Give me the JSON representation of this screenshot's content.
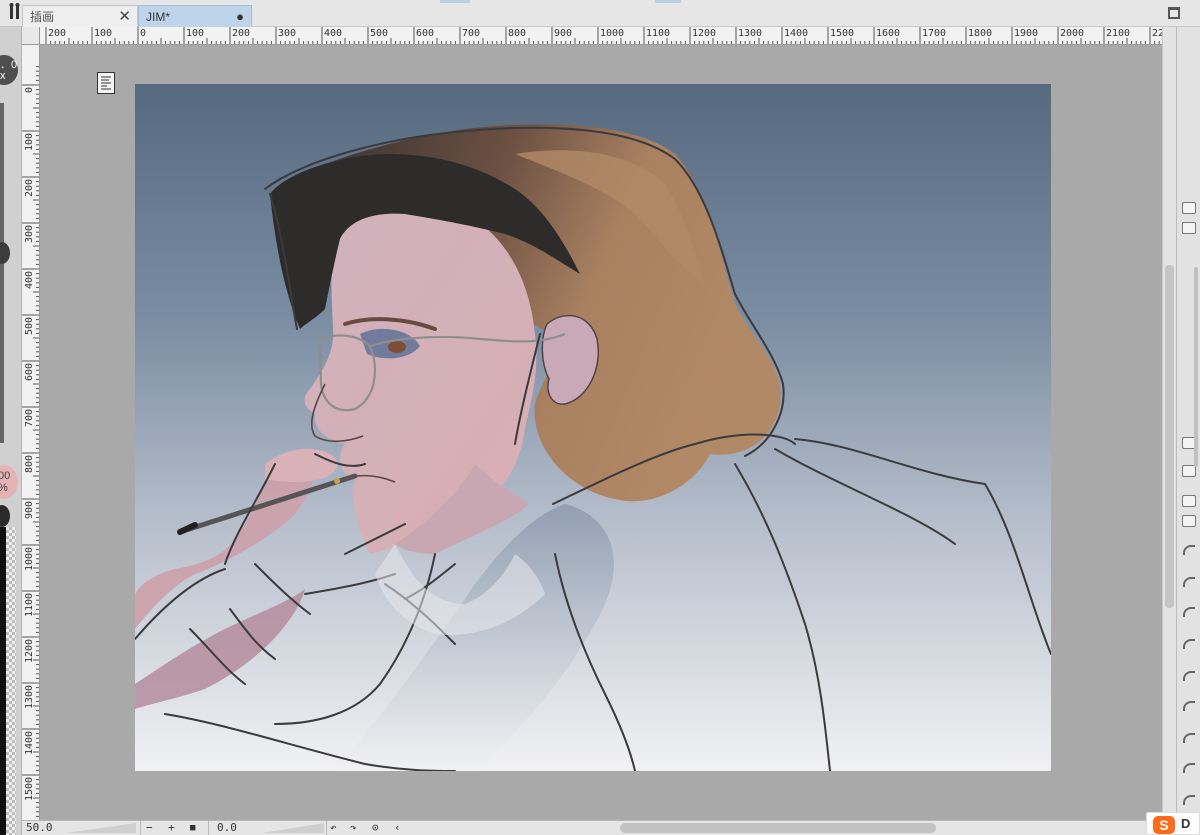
{
  "tabs": [
    {
      "label": "插画",
      "has_close": true
    },
    {
      "label": "JIM*",
      "active": true,
      "modified_dot": "●"
    }
  ],
  "tab_close_glyph": "✕",
  "left_panel": {
    "top_knob_text": "．0\nx",
    "mid_knob_text": "00\n%"
  },
  "ruler_top_labels": [
    "200",
    "100",
    "0",
    "100",
    "200",
    "300",
    "400",
    "500",
    "600",
    "700",
    "800",
    "900",
    "1000",
    "1100",
    "1200",
    "1300",
    "1400",
    "1500",
    "1600",
    "1700",
    "1800",
    "1900",
    "2000",
    "2100",
    "22"
  ],
  "ruler_left_labels": [
    "0",
    "100",
    "200",
    "300",
    "400",
    "500",
    "600",
    "700",
    "800",
    "900",
    "1000",
    "1100",
    "1200",
    "1300",
    "1400",
    "1500"
  ],
  "status_bar": {
    "zoom_value": "50.0",
    "zoom_out": "−",
    "zoom_in": "+",
    "fit_icon": "■",
    "rotation_value": "0.0",
    "rotate_left_icon": "↶",
    "rotate_right_icon": "↷",
    "reset_rotation_icon": "⊙",
    "scroll_left_icon": "‹"
  },
  "ime": {
    "logo_letter": "S",
    "letter": "D"
  },
  "colors": {
    "active_tab": "#bed4ea",
    "sky_top": "#5a7088",
    "sky_bottom": "#f1f1f3",
    "hair": "#a27c5c",
    "skin": "#d6b2b8",
    "ime_orange": "#ff6a1a"
  }
}
